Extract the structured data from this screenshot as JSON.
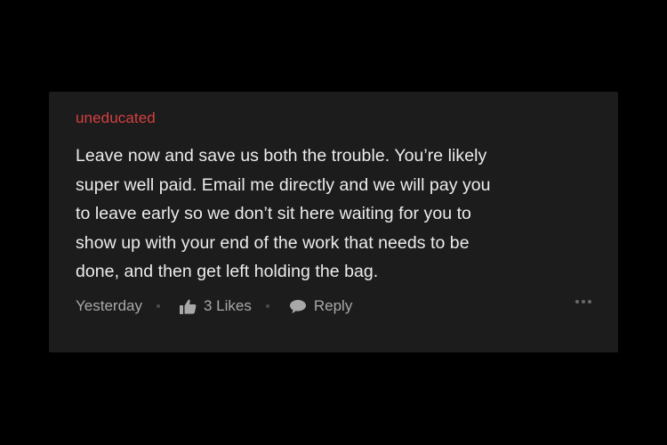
{
  "comment": {
    "author": "uneducated",
    "lines": [
      "Leave now and save us both the trouble. You’re likely",
      "super well paid. Email me directly and we will pay you",
      "to leave early so we don’t sit here waiting for you to",
      "show up with your end of the work that needs to be",
      "done, and then get left holding the bag."
    ],
    "timestamp": "Yesterday",
    "likes_label": "3 Likes",
    "reply_label": "Reply"
  },
  "colors": {
    "background": "#000000",
    "card": "#1c1c1c",
    "author": "#d2403f",
    "body_text": "#ececec",
    "meta_text": "#a8a8a8"
  },
  "icons": {
    "like": "thumbs-up-icon",
    "reply": "speech-bubble-icon",
    "more": "more-dots-icon"
  }
}
